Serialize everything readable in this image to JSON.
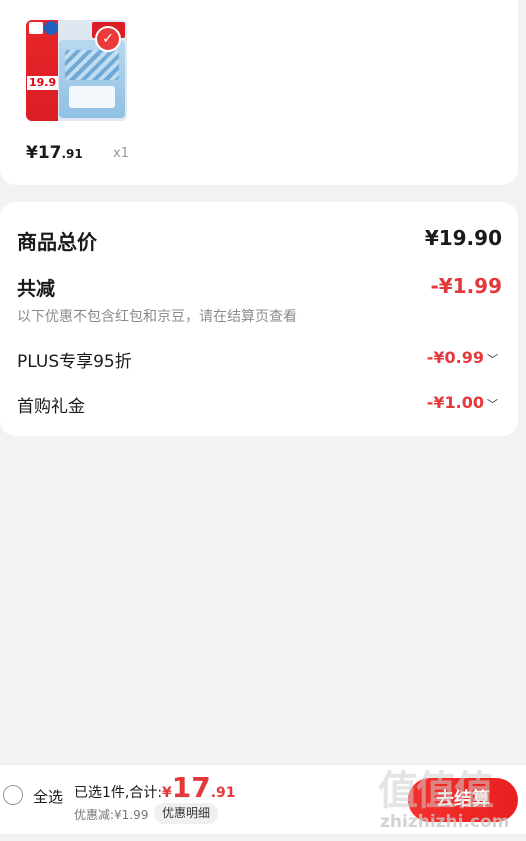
{
  "product": {
    "thumb_price": "19.9",
    "price_int": "¥17",
    "price_dec": ".91",
    "quantity": "x1"
  },
  "summary_card": {
    "total_label": "商品总价",
    "total_value": "¥19.90",
    "reduce_label": "共减",
    "reduce_value": "-¥1.99",
    "note": "以下优惠不包含红包和京豆，请在结算页查看",
    "discounts": [
      {
        "label": "PLUS专享95折",
        "value": "-¥0.99"
      },
      {
        "label": "首购礼金",
        "value": "-¥1.00"
      }
    ]
  },
  "bottom_bar": {
    "select_all": "全选",
    "selected_text": "已选1件,合计:",
    "currency": "¥",
    "total_int": "17",
    "total_dec": ".91",
    "discount_text": "优惠减:¥1.99",
    "detail_button": "优惠明细",
    "checkout_button": "去结算"
  },
  "watermark": {
    "logo": "值值值",
    "text": "zhizhizhi.com"
  },
  "colors": {
    "accent": "#e4393c",
    "background": "#f2f2f2"
  }
}
